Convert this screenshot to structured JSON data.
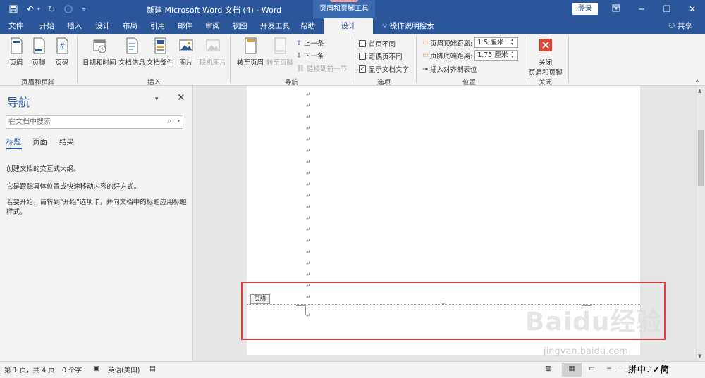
{
  "titlebar": {
    "doc_title": "新建 Microsoft Word 文档 (4)  -  Word",
    "contextual_tools": "页眉和页脚工具",
    "login": "登录",
    "quick_access": [
      "save-icon",
      "undo-icon",
      "redo-icon",
      "circle-icon",
      "customize-icon"
    ],
    "window_buttons": [
      "ribbon-display-icon",
      "minimize-icon",
      "restore-icon",
      "close-icon"
    ]
  },
  "tabs": [
    {
      "label": "文件"
    },
    {
      "label": "开始"
    },
    {
      "label": "插入"
    },
    {
      "label": "设计"
    },
    {
      "label": "布局"
    },
    {
      "label": "引用"
    },
    {
      "label": "邮件"
    },
    {
      "label": "审阅"
    },
    {
      "label": "视图"
    },
    {
      "label": "开发工具"
    },
    {
      "label": "帮助"
    },
    {
      "label": "设计"
    }
  ],
  "tellme": "操作说明搜索",
  "share": "共享",
  "ribbon": {
    "hf_group": {
      "label": "页眉和页脚",
      "header": "页眉",
      "footer": "页脚",
      "pagenum": "页码"
    },
    "insert_group": {
      "label": "插入",
      "datetime": "日期和时间",
      "docinfo": "文档信息",
      "docparts": "文档部件",
      "picture": "图片",
      "online_picture": "联机图片"
    },
    "nav_group": {
      "label": "导航",
      "goto_header": "转至页眉",
      "goto_footer": "转至页脚",
      "previous": "上一条",
      "next": "下一条",
      "link_previous": "链接到前一节"
    },
    "options_group": {
      "label": "选项",
      "diff_first": "首页不同",
      "diff_odd_even": "奇偶页不同",
      "show_doc_text": "显示文档文字",
      "show_doc_text_checked": true
    },
    "position_group": {
      "label": "位置",
      "header_top": "页眉顶端距离:",
      "header_top_value": "1.5 厘米",
      "footer_bottom": "页脚底端距离:",
      "footer_bottom_value": "1.75 厘米",
      "align_tab": "插入对齐制表位"
    },
    "close_group": {
      "label": "关闭",
      "close_line1": "关闭",
      "close_line2": "页眉和页脚"
    }
  },
  "nav": {
    "title": "导航",
    "search_placeholder": "在文档中搜索",
    "tabs": [
      "标题",
      "页面",
      "结果"
    ],
    "text1": "创建文档的交互式大纲。",
    "text2": "它是跟踪具体位置或快速移动内容的好方式。",
    "text3": "若要开始，请转到\"开始\"选项卡，并向文档中的标题应用标题样式。"
  },
  "document": {
    "para_mark": "↵",
    "footer_tag": "页脚"
  },
  "watermark": {
    "text": "Baidu经验",
    "sub": "jingyan.baidu.com"
  },
  "status": {
    "page": "第 1 页，共 4 页",
    "words": "0 个字",
    "language": "英语(美国)",
    "ime": "拼中♪✔简"
  },
  "colors": {
    "accent": "#2b579a",
    "highlight_box": "#e43d3d"
  }
}
